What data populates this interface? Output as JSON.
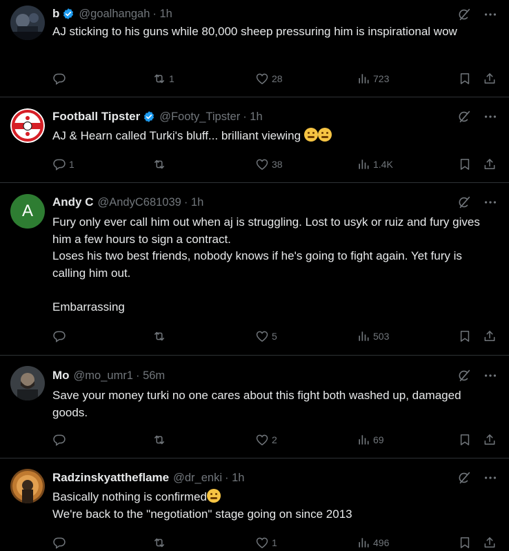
{
  "colors": {
    "background": "#000000",
    "text": "#e7e9ea",
    "muted": "#71767b",
    "verified": "#1d9bf0",
    "divider": "#2f3336"
  },
  "tweets": [
    {
      "name": "b",
      "verified": true,
      "handle": "@goalhangah",
      "time": "· 1h",
      "text": "AJ sticking to his guns while 80,000 sheep pressuring him is inspirational wow",
      "emoji_suffix": "",
      "replies": "",
      "reposts": "1",
      "likes": "28",
      "views": "723"
    },
    {
      "name": "Football Tipster",
      "verified": true,
      "handle": "@Footy_Tipster",
      "time": "· 1h",
      "text": "AJ & Hearn called Turki's bluff... brilliant viewing",
      "emoji_suffix": "rofl-rofl",
      "replies": "1",
      "reposts": "",
      "likes": "38",
      "views": "1.4K"
    },
    {
      "name": "Andy C",
      "verified": false,
      "handle": "@AndyC681039",
      "time": "· 1h",
      "avatar_letter": "A",
      "text": "Fury only ever call him out when aj is struggling. Lost to usyk or ruiz and fury gives him a few hours to sign a contract.\nLoses his two best friends, nobody knows if he's going to fight again. Yet fury is calling him out.\n\nEmbarrassing",
      "emoji_suffix": "",
      "replies": "",
      "reposts": "",
      "likes": "5",
      "views": "503"
    },
    {
      "name": "Mo",
      "verified": false,
      "handle": "@mo_umr1",
      "time": "· 56m",
      "text": "Save your money turki no one cares about this fight both washed up, damaged goods.",
      "emoji_suffix": "",
      "replies": "",
      "reposts": "",
      "likes": "2",
      "views": "69"
    },
    {
      "name": "Radzinskyattheflame",
      "verified": false,
      "handle": "@dr_enki",
      "time": "· 1h",
      "text_line1": "Basically nothing is confirmed",
      "text_line2": "We're back to the \"negotiation\" stage going on since 2013",
      "emoji_suffix": "raised-eyebrow",
      "replies": "",
      "reposts": "",
      "likes": "1",
      "views": "496"
    }
  ]
}
